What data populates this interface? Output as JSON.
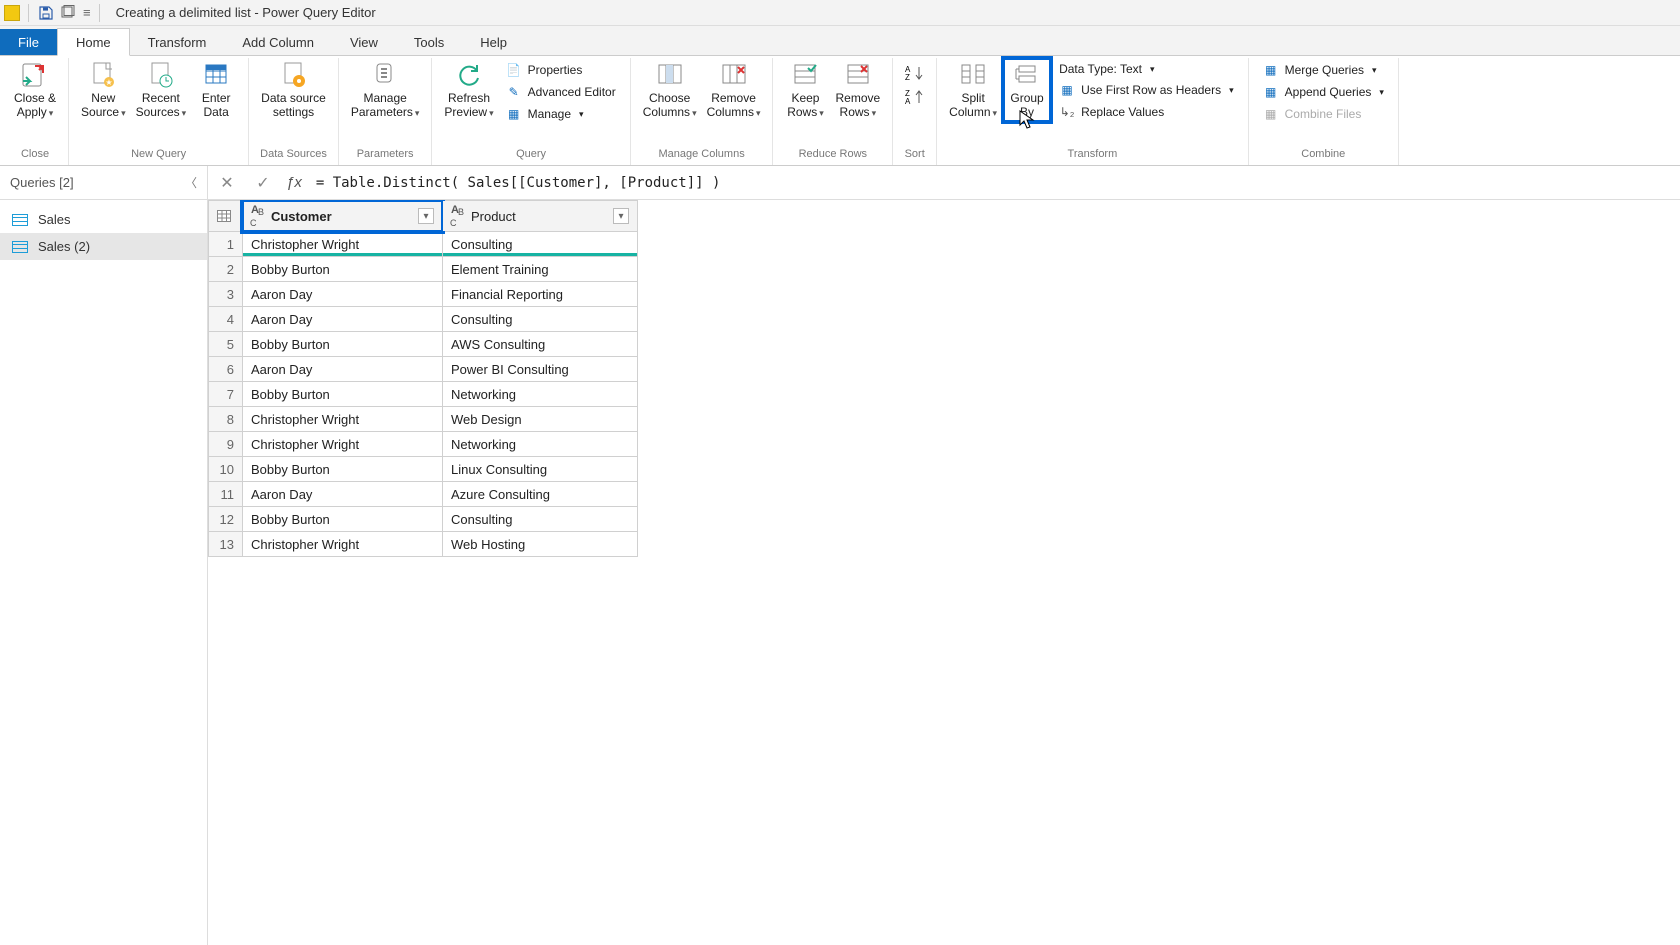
{
  "title": "Creating a delimited list - Power Query Editor",
  "tabs": {
    "file": "File",
    "home": "Home",
    "transform": "Transform",
    "addcolumn": "Add Column",
    "view": "View",
    "tools": "Tools",
    "help": "Help"
  },
  "ribbon": {
    "close": {
      "close_apply": "Close &\nApply",
      "group": "Close"
    },
    "newquery": {
      "new_source": "New\nSource",
      "recent_sources": "Recent\nSources",
      "enter_data": "Enter\nData",
      "group": "New Query"
    },
    "datasources": {
      "settings": "Data source\nsettings",
      "group": "Data Sources"
    },
    "parameters": {
      "manage": "Manage\nParameters",
      "group": "Parameters"
    },
    "query": {
      "refresh": "Refresh\nPreview",
      "properties": "Properties",
      "advanced": "Advanced Editor",
      "manage": "Manage",
      "group": "Query"
    },
    "managecols": {
      "choose": "Choose\nColumns",
      "remove": "Remove\nColumns",
      "group": "Manage Columns"
    },
    "reducerows": {
      "keep": "Keep\nRows",
      "remove": "Remove\nRows",
      "group": "Reduce Rows"
    },
    "sort": {
      "group": "Sort"
    },
    "transform": {
      "split": "Split\nColumn",
      "group_by": "Group\nBy",
      "datatype": "Data Type: Text",
      "first_row": "Use First Row as Headers",
      "replace": "Replace Values",
      "glabel": "Transform"
    },
    "combine": {
      "merge": "Merge Queries",
      "append": "Append Queries",
      "combine_files": "Combine Files",
      "group": "Combine"
    }
  },
  "queries_pane": {
    "header": "Queries [2]",
    "items": [
      {
        "label": "Sales"
      },
      {
        "label": "Sales (2)"
      }
    ]
  },
  "formula": "= Table.Distinct( Sales[[Customer], [Product]] )",
  "columns": {
    "customer": "Customer",
    "product": "Product"
  },
  "rows": [
    {
      "n": 1,
      "customer": "Christopher Wright",
      "product": "Consulting"
    },
    {
      "n": 2,
      "customer": "Bobby Burton",
      "product": "Element Training"
    },
    {
      "n": 3,
      "customer": "Aaron Day",
      "product": "Financial Reporting"
    },
    {
      "n": 4,
      "customer": "Aaron Day",
      "product": "Consulting"
    },
    {
      "n": 5,
      "customer": "Bobby Burton",
      "product": "AWS Consulting"
    },
    {
      "n": 6,
      "customer": "Aaron Day",
      "product": "Power BI Consulting"
    },
    {
      "n": 7,
      "customer": "Bobby Burton",
      "product": "Networking"
    },
    {
      "n": 8,
      "customer": "Christopher Wright",
      "product": "Web Design"
    },
    {
      "n": 9,
      "customer": "Christopher Wright",
      "product": "Networking"
    },
    {
      "n": 10,
      "customer": "Bobby Burton",
      "product": "Linux Consulting"
    },
    {
      "n": 11,
      "customer": "Aaron Day",
      "product": "Azure Consulting"
    },
    {
      "n": 12,
      "customer": "Bobby Burton",
      "product": "Consulting"
    },
    {
      "n": 13,
      "customer": "Christopher Wright",
      "product": "Web Hosting"
    }
  ]
}
